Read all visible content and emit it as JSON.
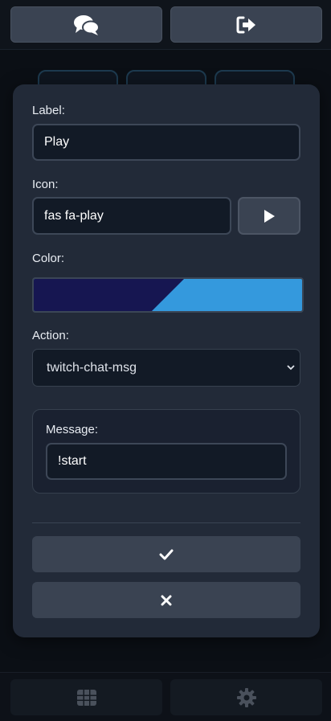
{
  "topbar": {
    "chat_button_icon": "comments-icon",
    "logout_button_icon": "sign-out-icon"
  },
  "form": {
    "label_caption": "Label:",
    "label_value": "Play",
    "icon_caption": "Icon:",
    "icon_value": "fas fa-play",
    "icon_preview": "play-icon",
    "color_caption": "Color:",
    "color_primary": "#161651",
    "color_secondary": "#3499dd",
    "action_caption": "Action:",
    "action_selected": "twitch-chat-msg",
    "message_caption": "Message:",
    "message_value": "!start",
    "confirm_icon": "check-icon",
    "cancel_icon": "close-icon"
  },
  "bottombar": {
    "grid_icon": "grid-icon",
    "settings_icon": "gear-icon"
  }
}
